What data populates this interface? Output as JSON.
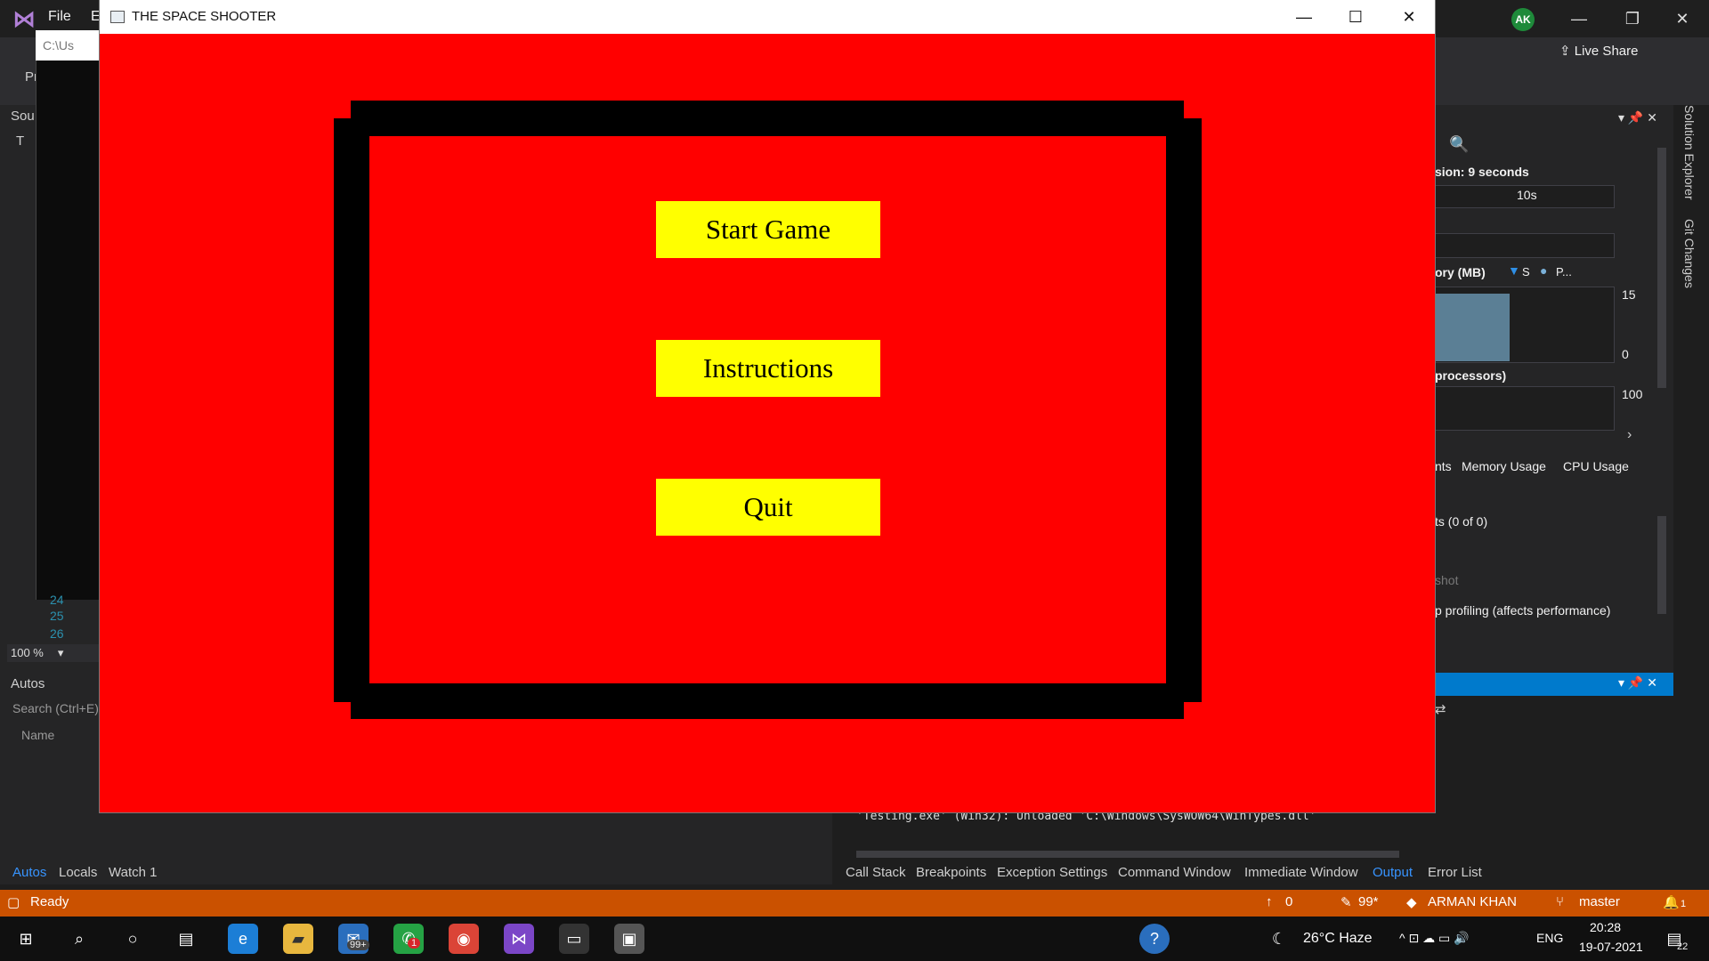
{
  "vs": {
    "menu": [
      "File",
      "Ed"
    ],
    "avatar": "AK",
    "live_share": "Live Share",
    "console_path": "C:\\Us",
    "left_labels": {
      "pr": "Pr",
      "sou": "Sou",
      "t": "T"
    },
    "line_numbers": [
      "24",
      "25",
      "26"
    ],
    "zoom": "100 %"
  },
  "autos": {
    "title": "Autos",
    "search_placeholder": "Search (Ctrl+E)",
    "name_col": "Name"
  },
  "bottom_tabs_left": [
    "Autos",
    "Locals",
    "Watch 1"
  ],
  "bottom_tabs_right": [
    "Call Stack",
    "Breakpoints",
    "Exception Settings",
    "Command Window",
    "Immediate Window",
    "Output",
    "Error List"
  ],
  "output": {
    "line": "'Testing.exe' (Win32): Unloaded 'C:\\Windows\\SysWOW64\\WinTypes.dll'"
  },
  "diagnostics": {
    "session": "sion: 9 seconds",
    "tick_10s": "10s",
    "memory_label": "ory (MB)",
    "legend_s": "S",
    "legend_p": "P...",
    "mem_max": "15",
    "mem_min": "0",
    "cpu_label": "processors)",
    "cpu_max": "100",
    "tabs": [
      "nts",
      "Memory Usage",
      "CPU Usage"
    ],
    "events": "ts (0 of 0)",
    "snapshot": "shot",
    "heap": "p profiling (affects performance)"
  },
  "side_tabs": [
    "Solution Explorer",
    "Git Changes"
  ],
  "status": {
    "ready": "Ready",
    "up_count": "0",
    "pencil_count": "99*",
    "user": "ARMAN KHAN",
    "branch": "master",
    "notif": "1"
  },
  "taskbar": {
    "mail_badge": "99+",
    "whatsapp_badge": "1",
    "weather": "26°C  Haze",
    "lang": "ENG",
    "time": "20:28",
    "date": "19-07-2021",
    "notif_count": "22"
  },
  "game": {
    "window_title": "THE SPACE SHOOTER",
    "buttons": [
      "Start Game",
      "Instructions",
      "Quit"
    ],
    "colors": {
      "background": "#ff0000",
      "frame": "#000000",
      "button": "#ffff00"
    }
  }
}
